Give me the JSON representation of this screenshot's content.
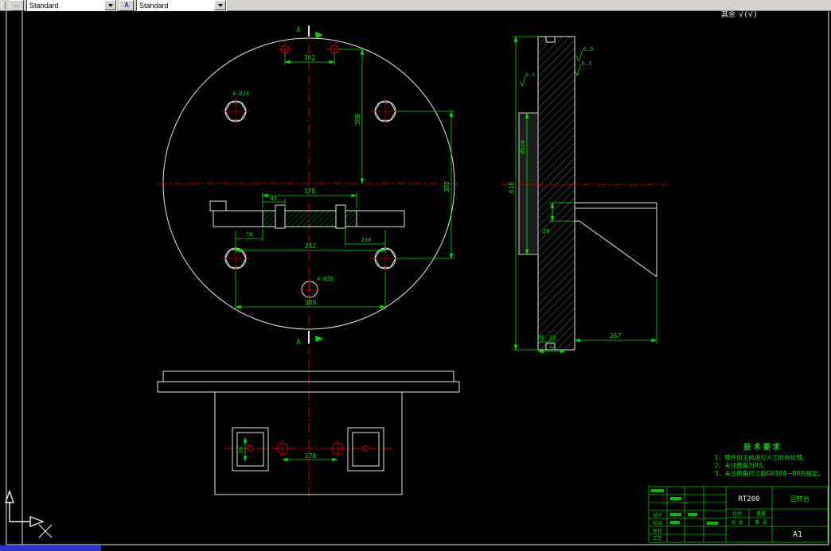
{
  "toolbar": {
    "dim_style_value": "Standard",
    "text_style_value": "Standard"
  },
  "corner_note": {
    "text": "其余",
    "symbol": "√(√)"
  },
  "section": {
    "top": "A",
    "bottom": "A"
  },
  "top_view": {
    "dim_162": "162",
    "dim_178": "178",
    "dim_45": "45",
    "dim_70": "70",
    "dim_210": "210",
    "dim_242": "242",
    "dim_389": "389",
    "dim_388": "388",
    "dim_302": "302",
    "label_bolt_holes": "4-Ø24",
    "label_center_holes": "4-Ø28"
  },
  "side_view": {
    "dim_610": "610",
    "dim_dia": "Ø520",
    "dim_24": "24",
    "dim_20": "20",
    "dim_22": "22",
    "dim_50": "50",
    "dim_267": "267",
    "roughness_a": "6.3",
    "roughness_b": "6.3",
    "roughness_c": "6.3"
  },
  "bottom_view": {
    "dim_178": "178",
    "dim_36": "36"
  },
  "tech_notes": {
    "title": "技 术 要 求",
    "lines": [
      "1、铸件加工前进行人工时效处理。",
      "2、未注圆角为R3。",
      "3、未注倒角尺寸按GB184—80的规定。"
    ]
  },
  "title_block": {
    "drawing_no": "RT200",
    "part_name": "回转台",
    "sheet_size": "A1",
    "scale_label": "比例",
    "weight_label": "重量",
    "sheets_label": "共 张",
    "page_label": "第 张",
    "rows": [
      "设计",
      "校对",
      "审核",
      "工艺"
    ]
  }
}
